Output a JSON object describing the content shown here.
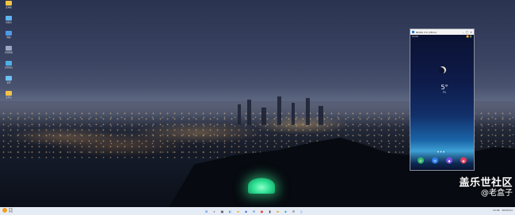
{
  "desktop": {
    "icons": [
      {
        "label": "此电脑",
        "icon": "folder-icon",
        "color": "#f5c542"
      },
      {
        "label": "回收站",
        "icon": "monitor-icon",
        "color": "#5fb4f0"
      },
      {
        "label": "网络",
        "icon": "network-icon",
        "color": "#4f9ae6"
      },
      {
        "label": "控制面板",
        "icon": "panel-icon",
        "color": "#9aa7c2"
      },
      {
        "label": "应用商店",
        "icon": "app-icon",
        "color": "#4fb0e8"
      },
      {
        "label": "设置",
        "icon": "settings-icon",
        "color": "#6cc2f0"
      },
      {
        "label": "文件夹",
        "icon": "folder-icon",
        "color": "#f2c24d"
      }
    ]
  },
  "phone_window": {
    "title": "NODA 3.0 | Mirror",
    "controls": [
      "–",
      "□",
      "✕"
    ],
    "status_left": "10:06",
    "status_right": "📶 🔋",
    "weather_temp": "5°",
    "weather_line": "多云",
    "dock_apps": [
      {
        "icon": "phone-icon",
        "glyph": "✆",
        "color": "#2fb56a"
      },
      {
        "icon": "messages-icon",
        "glyph": "✉",
        "color": "#2f7de8"
      },
      {
        "icon": "store-icon",
        "glyph": "◆",
        "color": "#7b4de0"
      },
      {
        "icon": "camera-icon",
        "glyph": "◉",
        "color": "#e83a5a"
      }
    ]
  },
  "watermark": {
    "line1": "盖乐世社区",
    "line2": "@老盒子"
  },
  "taskbar": {
    "weather_temp": "2°C",
    "weather_desc": "多云",
    "center_apps": [
      {
        "icon": "windows-start-icon",
        "glyph": "⊞",
        "color": "#1e6fd9"
      },
      {
        "icon": "search-icon",
        "glyph": "⌕",
        "color": "#333333"
      },
      {
        "icon": "task-view-icon",
        "glyph": "▣",
        "color": "#444444"
      },
      {
        "icon": "edge-icon",
        "glyph": "◐",
        "color": "#1a9bd7"
      },
      {
        "icon": "explorer-icon",
        "glyph": "▬",
        "color": "#f0b83a"
      },
      {
        "icon": "store-icon",
        "glyph": "◆",
        "color": "#2a7be0"
      },
      {
        "icon": "mail-icon",
        "glyph": "✉",
        "color": "#1a73d9"
      },
      {
        "icon": "chrome-icon",
        "glyph": "●",
        "color": "#e94235"
      },
      {
        "icon": "terminal-icon",
        "glyph": "▮",
        "color": "#333333"
      },
      {
        "icon": "folder-icon",
        "glyph": "▬",
        "color": "#e8a93a"
      },
      {
        "icon": "photos-icon",
        "glyph": "◈",
        "color": "#0f9ed6"
      },
      {
        "icon": "settings-icon",
        "glyph": "⚙",
        "color": "#555555"
      },
      {
        "icon": "phone-link-icon",
        "glyph": "▯",
        "color": "#2b6fe0"
      }
    ],
    "tray_time": "10:06",
    "tray_date": "2022/3/1"
  }
}
